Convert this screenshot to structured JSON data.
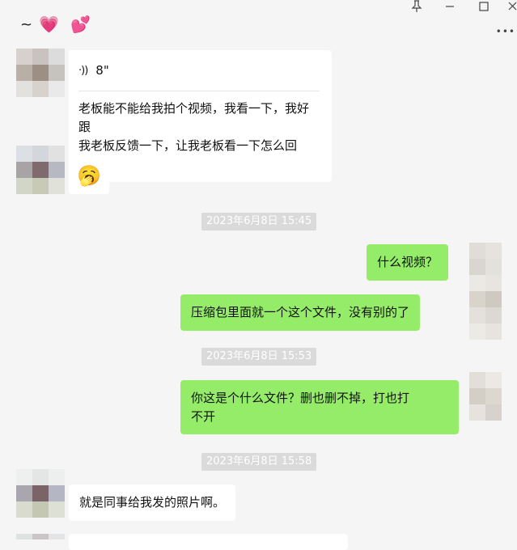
{
  "window": {
    "title_prefix": "~",
    "heart_1": "💗",
    "heart_2": "💕",
    "pin_icon": "pin-icon",
    "minimize_label": "—",
    "maximize_label": "□",
    "close_label": "×",
    "more_label": "•••"
  },
  "messages": {
    "voice_duration": "8\"",
    "voice_transcript_line1": "老板能不能给我拍个视频，我看一下，我好跟",
    "voice_transcript_line2": "我老板反馈一下，让我老板看一下怎么回事。",
    "emoji_sticker": "🥱",
    "ts1": "2023年6月8日 15:45",
    "msg_right_1": "什么视频？",
    "msg_right_2": "压缩包里面就一个这个文件，没有别的了",
    "ts2": "2023年6月8日 15:53",
    "msg_right_3_line1": "你这是个什么文件？删也删不掉，打也打",
    "msg_right_3_line2": "不开",
    "ts3": "2023年6月8日 15:58",
    "msg_left_last": "就是同事给我发的照片啊。"
  },
  "colors": {
    "self_bubble": "#95ec69",
    "other_bubble": "#ffffff",
    "background": "#f5f5f5",
    "timestamp_bg": "#dadada"
  }
}
